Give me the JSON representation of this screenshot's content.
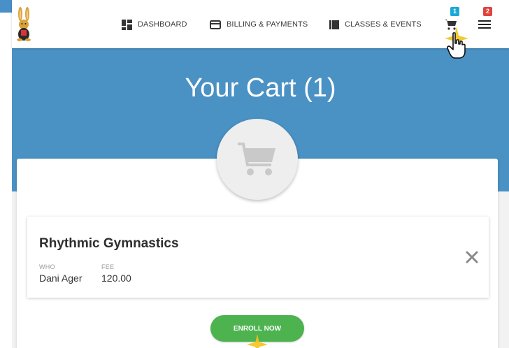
{
  "navbar": {
    "items": [
      {
        "label": "DASHBOARD",
        "icon": "dashboard-icon"
      },
      {
        "label": "BILLING & PAYMENTS",
        "icon": "credit-card-icon"
      },
      {
        "label": "CLASSES & EVENTS",
        "icon": "book-icon"
      }
    ],
    "cart_badge": "1",
    "menu_badge": "2"
  },
  "hero": {
    "title": "Your Cart (1)"
  },
  "cart_items": [
    {
      "title": "Rhythmic Gymnastics",
      "who_label": "WHO",
      "who_value": "Dani Ager",
      "fee_label": "FEE",
      "fee_value": "120.00"
    }
  ],
  "actions": {
    "enroll_label": "ENROLL NOW"
  },
  "colors": {
    "hero": "#4a91c4",
    "enroll": "#4cb34f",
    "cart_badge": "#1ba8d6",
    "menu_badge": "#e0443c"
  }
}
